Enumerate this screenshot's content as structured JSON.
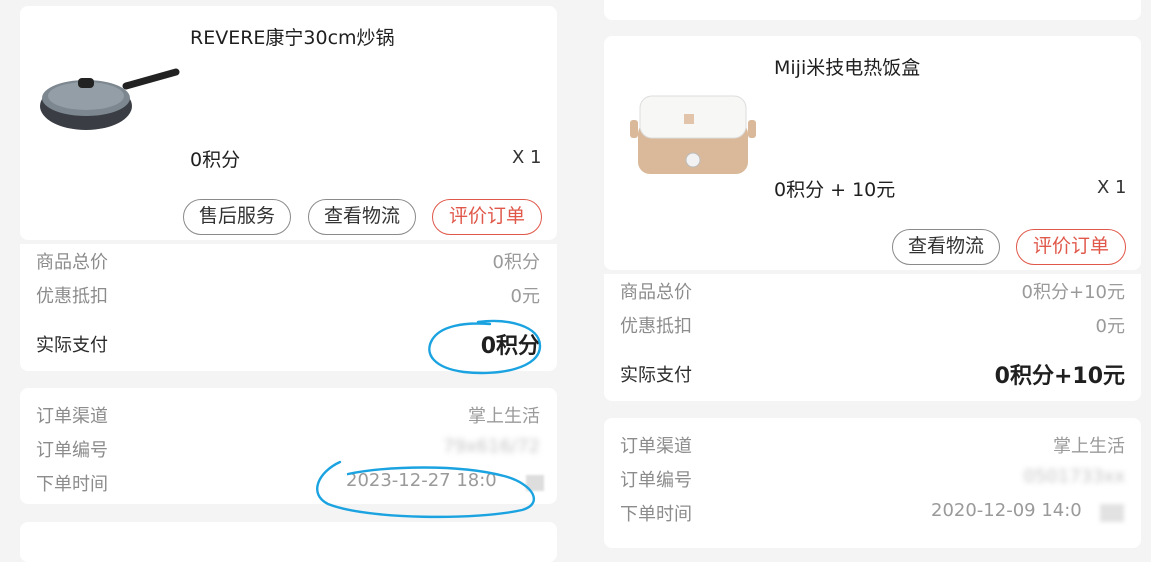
{
  "left": {
    "product": {
      "title": "REVERE康宁30cm炒锅",
      "price": "0积分",
      "qty": "X 1",
      "image_icon": "wok-pan-icon"
    },
    "buttons": {
      "after_sale": "售后服务",
      "logistics": "查看物流",
      "review": "评价订单"
    },
    "summary": {
      "total_label": "商品总价",
      "total_value": "0积分",
      "discount_label": "优惠抵扣",
      "discount_value": "0元",
      "paid_label": "实际支付",
      "paid_value": "0积分"
    },
    "order": {
      "channel_label": "订单渠道",
      "channel_value": "掌上生活",
      "number_label": "订单编号",
      "number_value": "79x616/72",
      "time_label": "下单时间",
      "time_value": "2023-12-27 18:0"
    }
  },
  "right": {
    "product": {
      "title": "Miji米技电热饭盒",
      "price": "0积分 + 10元",
      "qty": "X 1",
      "image_icon": "lunch-box-icon"
    },
    "buttons": {
      "logistics": "查看物流",
      "review": "评价订单"
    },
    "summary": {
      "total_label": "商品总价",
      "total_value": "0积分+10元",
      "discount_label": "优惠抵扣",
      "discount_value": "0元",
      "paid_label": "实际支付",
      "paid_value": "0积分+10元"
    },
    "order": {
      "channel_label": "订单渠道",
      "channel_value": "掌上生活",
      "number_label": "订单编号",
      "number_value": "0501733xx",
      "time_label": "下单时间",
      "time_value": "2020-12-09 14:0"
    }
  },
  "colors": {
    "accent_red": "#e0584a",
    "annotation_blue": "#1aa3e0",
    "background": "#f4f4f4"
  }
}
